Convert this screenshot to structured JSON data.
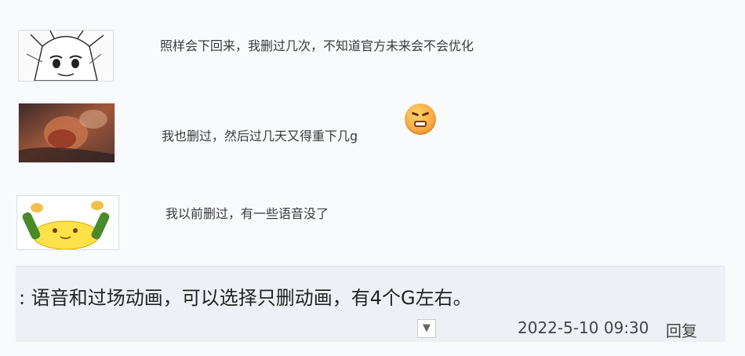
{
  "comments": [
    {
      "text": "照样会下回来，我删过几次，不知道官方未来会不会优化",
      "avatar": "manga-girl-avatar"
    },
    {
      "text": "我也删过，然后过几天又得重下几g",
      "avatar": "game-art-avatar",
      "emoji": "angry-face-emoji"
    },
    {
      "text": "我以前删过，有一些语音没了",
      "avatar": "yellow-blob-avatar"
    }
  ],
  "reply": {
    "text": ": 语音和过场动画，可以选择只删动画，有4个G左右。",
    "timestamp": "2022-5-10 09:30",
    "reply_label": "回复",
    "collapse_icon": "triangle-down-icon"
  },
  "colors": {
    "background": "#f9fafc",
    "reply_box": "#eef0f5",
    "emoji": "#f7a23a"
  }
}
